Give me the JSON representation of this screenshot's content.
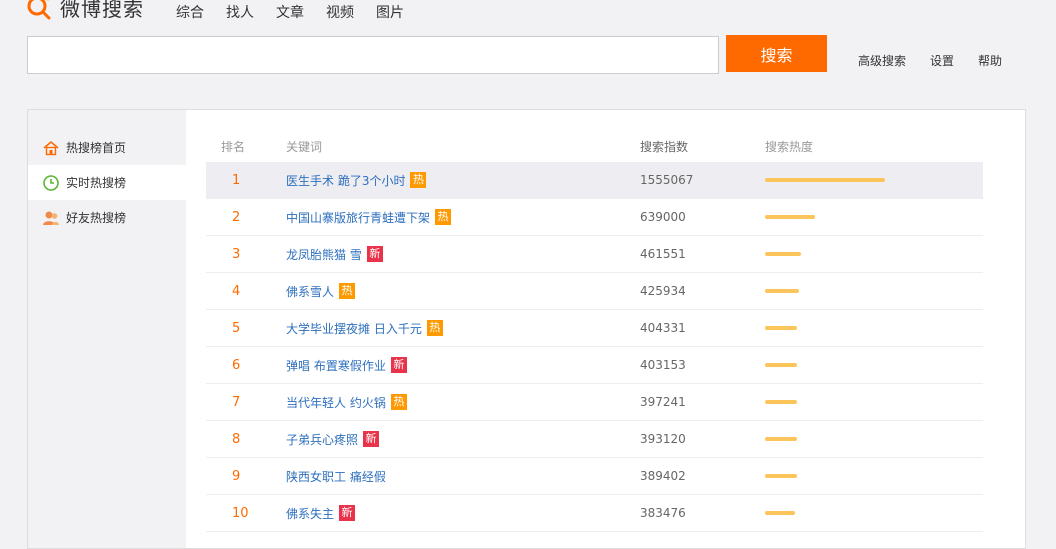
{
  "logo": {
    "text": "微博搜索",
    "accent": "#ff6a00"
  },
  "nav": [
    "综合",
    "找人",
    "文章",
    "视频",
    "图片"
  ],
  "search": {
    "placeholder": "",
    "button": "搜索"
  },
  "links": [
    "高级搜索",
    "设置",
    "帮助"
  ],
  "sidebar": {
    "items": [
      {
        "label": "热搜榜首页",
        "icon": "home-icon"
      },
      {
        "label": "实时热搜榜",
        "icon": "clock-icon"
      },
      {
        "label": "好友热搜榜",
        "icon": "people-icon"
      }
    ]
  },
  "table": {
    "headers": [
      "排名",
      "关键词",
      "搜索指数",
      "搜索热度"
    ],
    "rows": [
      {
        "rank": "1",
        "keyword": "医生手术 跪了3个小时",
        "badge": "热",
        "badge_type": "hot",
        "index": "1555067",
        "heat": 0.6
      },
      {
        "rank": "2",
        "keyword": "中国山寨版旅行青蛙遭下架",
        "badge": "热",
        "badge_type": "hot",
        "index": "639000",
        "heat": 0.25
      },
      {
        "rank": "3",
        "keyword": "龙凤胎熊猫 雪",
        "badge": "新",
        "badge_type": "new",
        "index": "461551",
        "heat": 0.18
      },
      {
        "rank": "4",
        "keyword": "佛系雪人",
        "badge": "热",
        "badge_type": "hot",
        "index": "425934",
        "heat": 0.17
      },
      {
        "rank": "5",
        "keyword": "大学毕业摆夜摊 日入千元",
        "badge": "热",
        "badge_type": "hot",
        "index": "404331",
        "heat": 0.16
      },
      {
        "rank": "6",
        "keyword": "弹唱 布置寒假作业",
        "badge": "新",
        "badge_type": "new",
        "index": "403153",
        "heat": 0.16
      },
      {
        "rank": "7",
        "keyword": "当代年轻人 约火锅",
        "badge": "热",
        "badge_type": "hot",
        "index": "397241",
        "heat": 0.16
      },
      {
        "rank": "8",
        "keyword": "子弟兵心疼照",
        "badge": "新",
        "badge_type": "new",
        "index": "393120",
        "heat": 0.16
      },
      {
        "rank": "9",
        "keyword": "陕西女职工 痛经假",
        "badge": "",
        "badge_type": "",
        "index": "389402",
        "heat": 0.16
      },
      {
        "rank": "10",
        "keyword": "佛系失主",
        "badge": "新",
        "badge_type": "new",
        "index": "383476",
        "heat": 0.15
      }
    ]
  }
}
